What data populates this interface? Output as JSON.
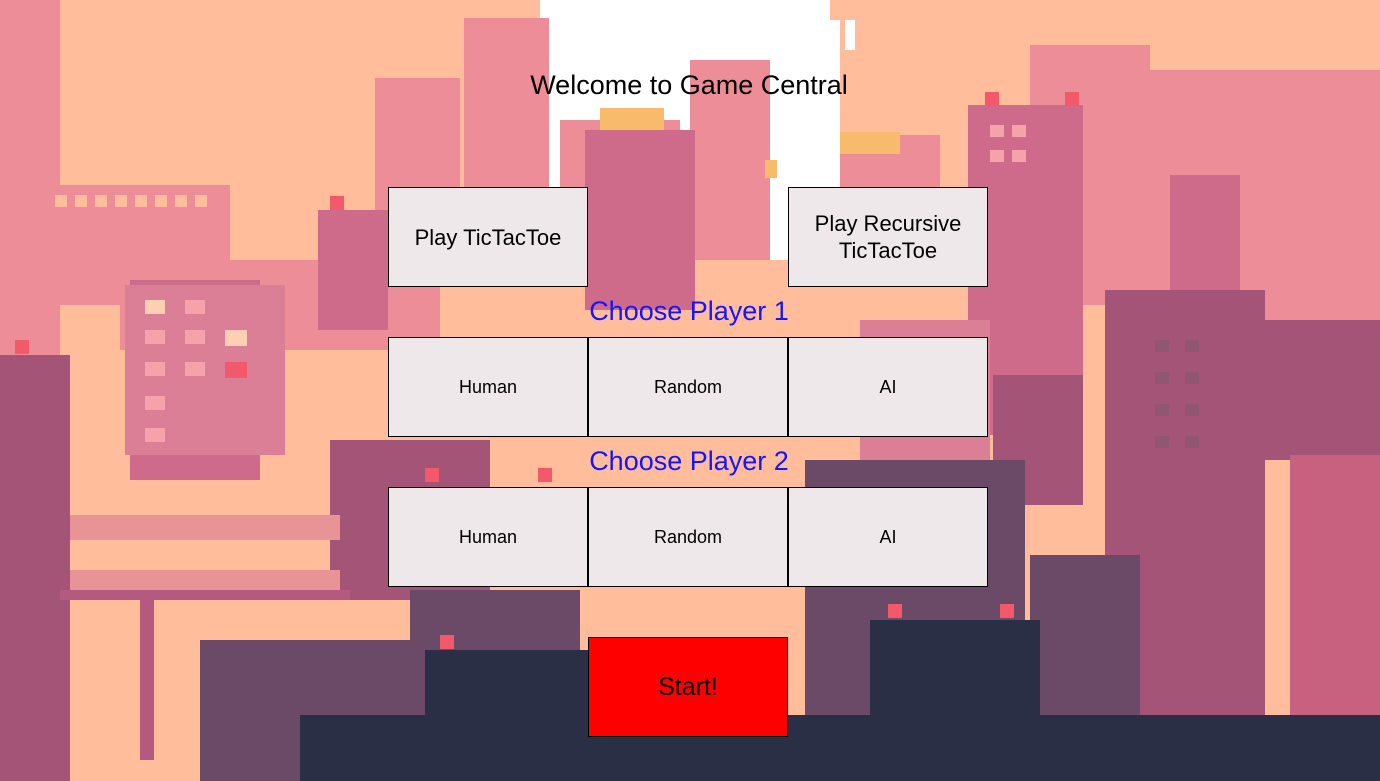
{
  "title": "Welcome to Game Central",
  "game_buttons": {
    "tictactoe": "Play TicTacToe",
    "recursive_line1": "Play Recursive",
    "recursive_line2": "TicTacToe"
  },
  "player1": {
    "heading": "Choose Player 1",
    "options": [
      "Human",
      "Random",
      "AI"
    ]
  },
  "player2": {
    "heading": "Choose Player 2",
    "options": [
      "Human",
      "Random",
      "AI"
    ]
  },
  "start_label": "Start!",
  "colors": {
    "sky": "#ffbd9c",
    "heading_text": "#1414ff",
    "start_button": "#ff0000",
    "button_face": "#fdf6f9"
  }
}
